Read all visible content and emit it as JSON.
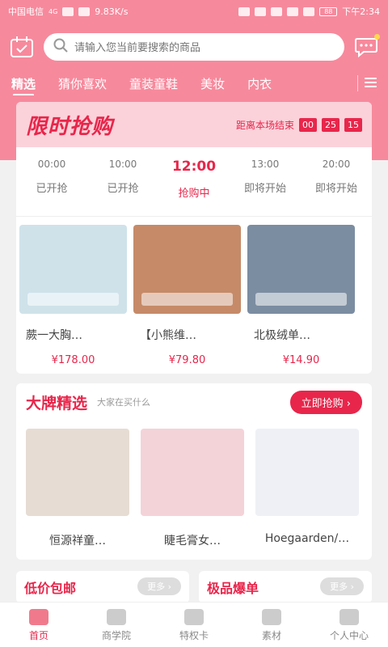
{
  "status_bar": {
    "carrier": "中国电信",
    "network": "4G",
    "speed": "9.83K/s",
    "battery": "88",
    "time": "下午2:34"
  },
  "header": {
    "search_placeholder": "请输入您当前要搜索的商品"
  },
  "tabs": [
    "精选",
    "猜你喜欢",
    "童装童鞋",
    "美妆",
    "内衣"
  ],
  "flash_sale": {
    "title": "限时抢购",
    "countdown_label": "距离本场结束",
    "countdown": [
      "00",
      "25",
      "15"
    ],
    "sessions": [
      {
        "time": "00:00",
        "state": "已开抢"
      },
      {
        "time": "10:00",
        "state": "已开抢"
      },
      {
        "time": "12:00",
        "state": "抢购中"
      },
      {
        "time": "13:00",
        "state": "即将开始"
      },
      {
        "time": "20:00",
        "state": "即将开始"
      }
    ],
    "products": [
      {
        "name": "蕨一大胸…",
        "price": "¥178.00",
        "color": "#cfe2ea"
      },
      {
        "name": "【小熊维…",
        "price": "¥79.80",
        "color": "#c68a68"
      },
      {
        "name": "北极绒单…",
        "price": "¥14.90",
        "color": "#7b8da1"
      }
    ]
  },
  "brand_section": {
    "title": "大牌精选",
    "subtitle": "大家在买什么",
    "button": "立即抢购",
    "items": [
      {
        "name": "恒源祥童…",
        "color": "#e6dcd3"
      },
      {
        "name": "睫毛膏女…",
        "color": "#f4d3d8"
      },
      {
        "name": "Hoegaarden/…",
        "color": "#eef0f5"
      }
    ]
  },
  "low_price": {
    "title": "低价包邮",
    "more": "更多"
  },
  "hot_items": {
    "title": "极品爆单",
    "more": "更多"
  },
  "bottom_nav": [
    "首页",
    "商学院",
    "特权卡",
    "素材",
    "个人中心"
  ]
}
